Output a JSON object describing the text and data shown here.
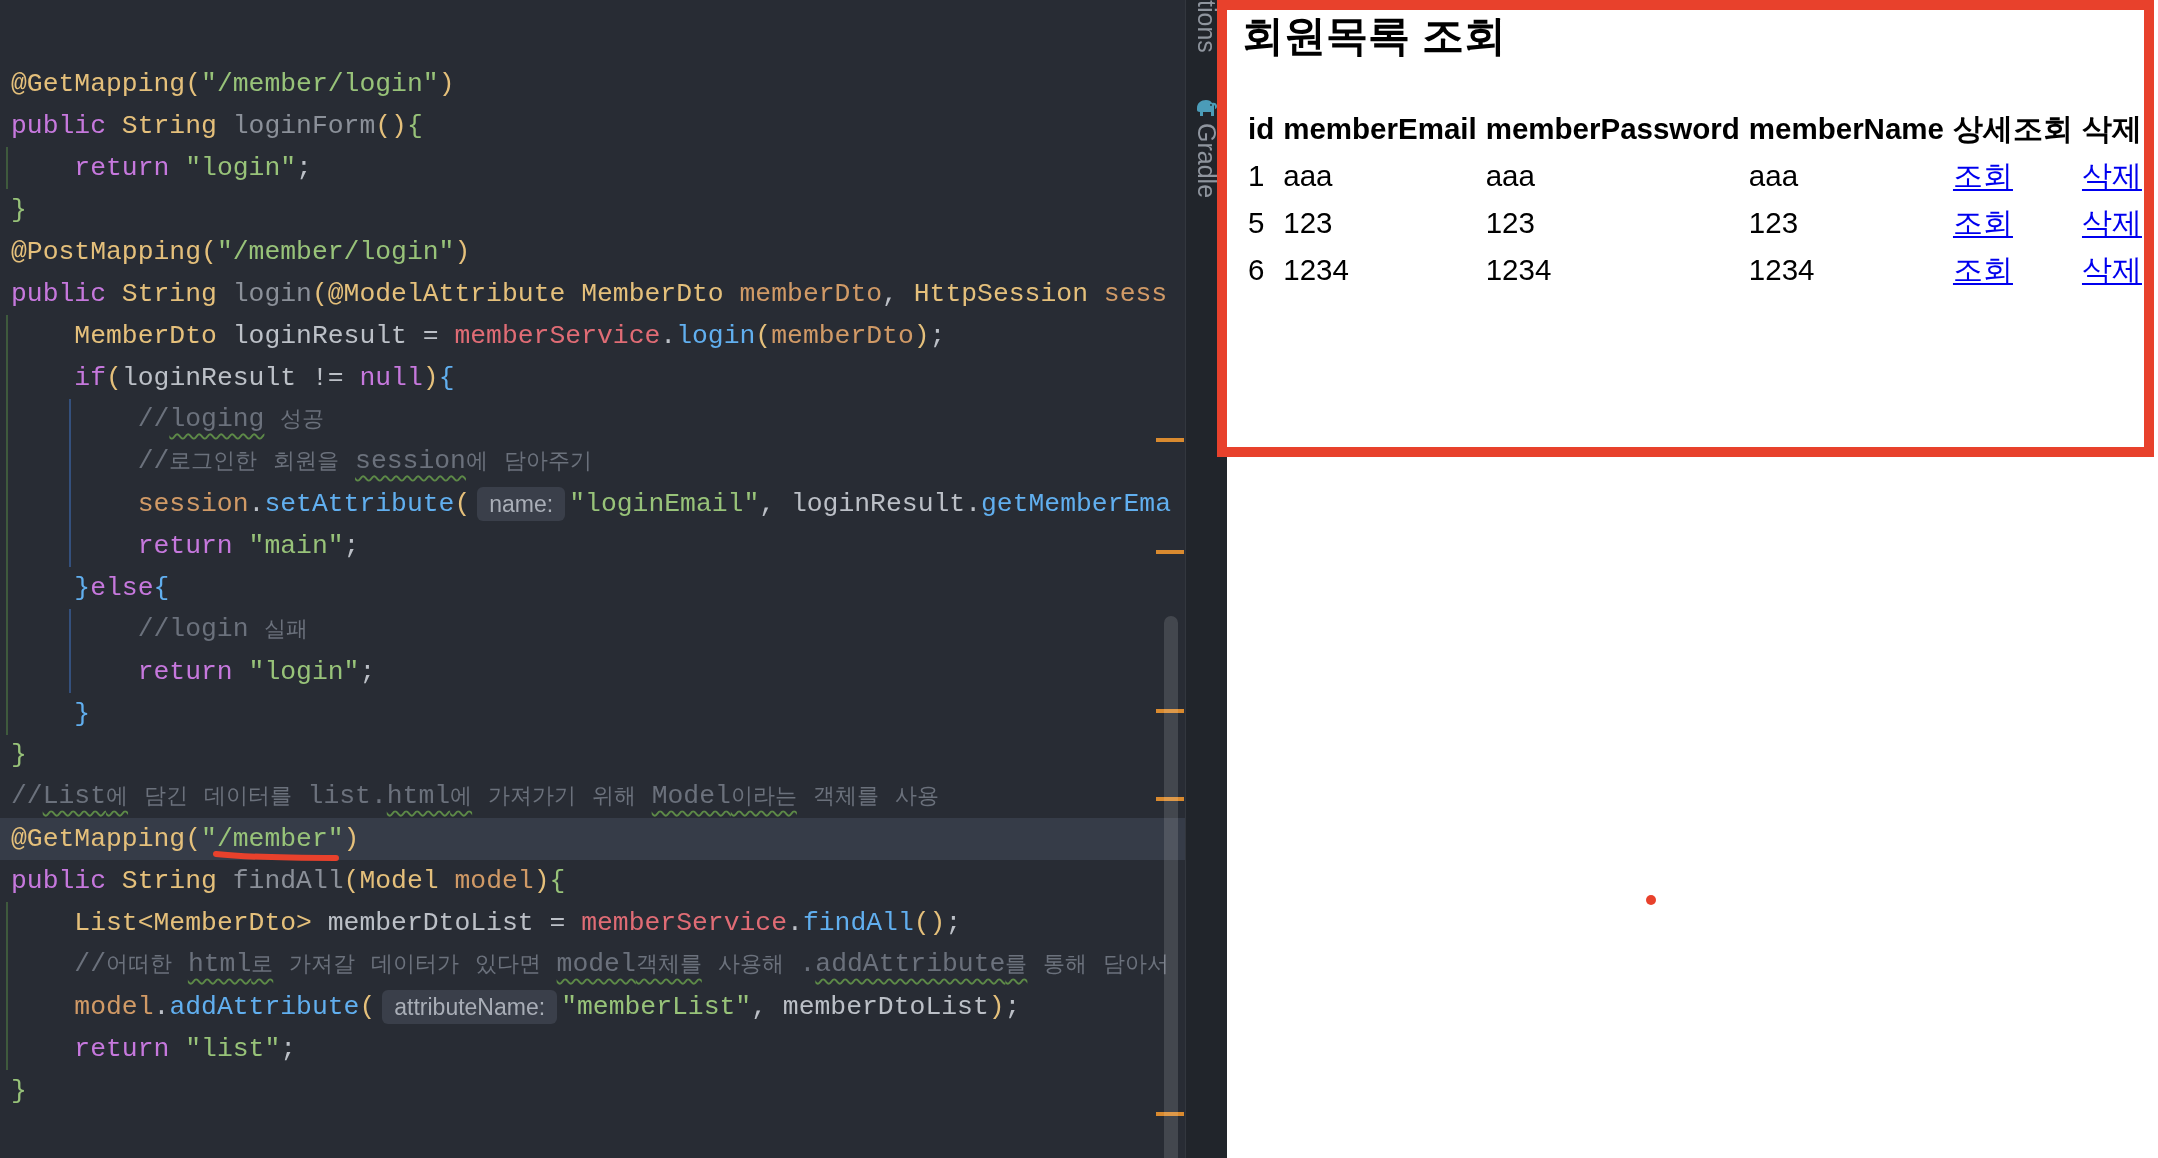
{
  "editor": {
    "lines": [
      {
        "highlighted": false,
        "tokens": [
          {
            "kind": "annotation",
            "text": "@GetMapping"
          },
          {
            "kind": "bracket",
            "text": "("
          },
          {
            "kind": "string",
            "text": "\"/member/login\""
          },
          {
            "kind": "bracket",
            "text": ")"
          }
        ]
      },
      {
        "highlighted": false,
        "tokens": [
          {
            "kind": "keyword",
            "text": "public "
          },
          {
            "kind": "type",
            "text": "String "
          },
          {
            "kind": "declaration",
            "text": "loginForm"
          },
          {
            "kind": "bracket",
            "text": "()"
          },
          {
            "kind": "brace_outer",
            "text": "{"
          }
        ],
        "children": [
          {
            "highlighted": false,
            "tokens": [
              {
                "kind": "keyword",
                "text": "return "
              },
              {
                "kind": "string",
                "text": "\"login\""
              },
              {
                "kind": "plain",
                "text": ";"
              }
            ]
          }
        ]
      },
      {
        "highlighted": false,
        "tokens": [
          {
            "kind": "brace_outer",
            "text": "}"
          }
        ]
      },
      {
        "highlighted": false,
        "tokens": [
          {
            "kind": "annotation",
            "text": "@PostMapping"
          },
          {
            "kind": "bracket",
            "text": "("
          },
          {
            "kind": "string",
            "text": "\"/member/login\""
          },
          {
            "kind": "bracket",
            "text": ")"
          }
        ]
      },
      {
        "highlighted": false,
        "tokens": [
          {
            "kind": "keyword",
            "text": "public "
          },
          {
            "kind": "type",
            "text": "String "
          },
          {
            "kind": "declaration",
            "text": "login"
          },
          {
            "kind": "bracket",
            "text": "("
          },
          {
            "kind": "annotation",
            "text": "@ModelAttribute "
          },
          {
            "kind": "type",
            "text": "MemberDto "
          },
          {
            "kind": "param",
            "text": "memberDto"
          },
          {
            "kind": "plain",
            "text": ", "
          },
          {
            "kind": "type",
            "text": "HttpSession "
          },
          {
            "kind": "param",
            "text": "sess"
          }
        ],
        "children": [
          {
            "highlighted": false,
            "tokens": [
              {
                "kind": "type",
                "text": "MemberDto "
              },
              {
                "kind": "plain",
                "text": "loginResult = "
              },
              {
                "kind": "field",
                "text": "memberService"
              },
              {
                "kind": "plain",
                "text": "."
              },
              {
                "kind": "method",
                "text": "login"
              },
              {
                "kind": "bracket",
                "text": "("
              },
              {
                "kind": "param",
                "text": "memberDto"
              },
              {
                "kind": "bracket",
                "text": ")"
              },
              {
                "kind": "plain",
                "text": ";"
              }
            ]
          },
          {
            "highlighted": false,
            "tokens": [
              {
                "kind": "keyword",
                "text": "if"
              },
              {
                "kind": "bracket",
                "text": "("
              },
              {
                "kind": "plain",
                "text": "loginResult != "
              },
              {
                "kind": "keyword",
                "text": "null"
              },
              {
                "kind": "bracket",
                "text": ")"
              },
              {
                "kind": "brace_inner",
                "text": "{"
              }
            ],
            "children": [
              {
                "highlighted": false,
                "tokens": [
                  {
                    "kind": "comment",
                    "text": "//"
                  },
                  {
                    "kind": "comment_typo",
                    "text": "loging"
                  },
                  {
                    "kind": "comment",
                    "text": " 성공"
                  }
                ]
              },
              {
                "highlighted": false,
                "tokens": [
                  {
                    "kind": "comment",
                    "text": "//로그인한 회원을 "
                  },
                  {
                    "kind": "comment_typo",
                    "text": "session"
                  },
                  {
                    "kind": "comment",
                    "text": "에 담아주기"
                  }
                ]
              },
              {
                "highlighted": false,
                "tokens": [
                  {
                    "kind": "param",
                    "text": "session"
                  },
                  {
                    "kind": "plain",
                    "text": "."
                  },
                  {
                    "kind": "method",
                    "text": "setAttribute"
                  },
                  {
                    "kind": "bracket",
                    "text": "("
                  },
                  {
                    "kind": "hint",
                    "text": "name:"
                  },
                  {
                    "kind": "string",
                    "text": "\"loginEmail\""
                  },
                  {
                    "kind": "plain",
                    "text": ", loginResult."
                  },
                  {
                    "kind": "method",
                    "text": "getMemberEma"
                  }
                ]
              },
              {
                "highlighted": false,
                "tokens": [
                  {
                    "kind": "keyword",
                    "text": "return "
                  },
                  {
                    "kind": "string",
                    "text": "\"main\""
                  },
                  {
                    "kind": "plain",
                    "text": ";"
                  }
                ]
              }
            ]
          },
          {
            "highlighted": false,
            "tokens": [
              {
                "kind": "brace_inner",
                "text": "}"
              },
              {
                "kind": "keyword",
                "text": "else"
              },
              {
                "kind": "brace_inner",
                "text": "{"
              }
            ],
            "children": [
              {
                "highlighted": false,
                "tokens": [
                  {
                    "kind": "comment",
                    "text": "//login 실패"
                  }
                ]
              },
              {
                "highlighted": false,
                "tokens": [
                  {
                    "kind": "keyword",
                    "text": "return "
                  },
                  {
                    "kind": "string",
                    "text": "\"login\""
                  },
                  {
                    "kind": "plain",
                    "text": ";"
                  }
                ]
              }
            ]
          },
          {
            "highlighted": false,
            "tokens": [
              {
                "kind": "brace_inner",
                "text": "}"
              }
            ]
          }
        ]
      },
      {
        "highlighted": false,
        "tokens": [
          {
            "kind": "brace_outer",
            "text": "}"
          }
        ]
      },
      {
        "highlighted": false,
        "tokens": [
          {
            "kind": "comment",
            "text": "//"
          },
          {
            "kind": "comment_typo",
            "text": "List에"
          },
          {
            "kind": "comment",
            "text": " 담긴 데이터를 list."
          },
          {
            "kind": "comment_typo",
            "text": "html에"
          },
          {
            "kind": "comment",
            "text": " 가져가기 위해 "
          },
          {
            "kind": "comment_typo",
            "text": "Model이라는"
          },
          {
            "kind": "comment",
            "text": " 객체를 사용"
          }
        ]
      },
      {
        "highlighted": true,
        "tokens": [
          {
            "kind": "annotation",
            "text": "@GetMapping"
          },
          {
            "kind": "bracket",
            "text": "("
          },
          {
            "kind": "string",
            "text": "\"/member\""
          },
          {
            "kind": "bracket",
            "text": ")"
          }
        ]
      },
      {
        "highlighted": false,
        "tokens": [
          {
            "kind": "keyword",
            "text": "public "
          },
          {
            "kind": "type",
            "text": "String "
          },
          {
            "kind": "declaration",
            "text": "findAll"
          },
          {
            "kind": "bracket",
            "text": "("
          },
          {
            "kind": "type",
            "text": "Model "
          },
          {
            "kind": "param",
            "text": "model"
          },
          {
            "kind": "bracket",
            "text": ")"
          },
          {
            "kind": "brace_outer",
            "text": "{"
          }
        ],
        "children": [
          {
            "highlighted": false,
            "tokens": [
              {
                "kind": "type",
                "text": "List<MemberDto> "
              },
              {
                "kind": "plain",
                "text": "memberDtoList = "
              },
              {
                "kind": "field",
                "text": "memberService"
              },
              {
                "kind": "plain",
                "text": "."
              },
              {
                "kind": "method",
                "text": "findAll"
              },
              {
                "kind": "bracket",
                "text": "()"
              },
              {
                "kind": "plain",
                "text": ";"
              }
            ]
          },
          {
            "highlighted": false,
            "tokens": [
              {
                "kind": "comment",
                "text": "//어떠한 "
              },
              {
                "kind": "comment_typo",
                "text": "html로"
              },
              {
                "kind": "comment",
                "text": " 가져갈 데이터가 있다면 "
              },
              {
                "kind": "comment_typo",
                "text": "model객체를"
              },
              {
                "kind": "comment",
                "text": " 사용해 ."
              },
              {
                "kind": "comment_typo",
                "text": "addAttribute를"
              },
              {
                "kind": "comment",
                "text": " 통해 담아서"
              }
            ]
          },
          {
            "highlighted": false,
            "tokens": [
              {
                "kind": "param",
                "text": "model"
              },
              {
                "kind": "plain",
                "text": "."
              },
              {
                "kind": "method",
                "text": "addAttribute"
              },
              {
                "kind": "bracket",
                "text": "("
              },
              {
                "kind": "hint",
                "text": "attributeName:"
              },
              {
                "kind": "string",
                "text": "\"memberList\""
              },
              {
                "kind": "plain",
                "text": ", memberDtoList"
              },
              {
                "kind": "bracket",
                "text": ")"
              },
              {
                "kind": "plain",
                "text": ";"
              }
            ]
          },
          {
            "highlighted": false,
            "tokens": [
              {
                "kind": "keyword",
                "text": "return "
              },
              {
                "kind": "string",
                "text": "\"list\""
              },
              {
                "kind": "plain",
                "text": ";"
              }
            ]
          }
        ]
      },
      {
        "highlighted": false,
        "tokens": [
          {
            "kind": "brace_outer",
            "text": "}"
          }
        ]
      }
    ]
  },
  "tool_windows": [
    {
      "label": "tions",
      "kind": "text"
    },
    {
      "label": "Gradle",
      "kind": "gradle"
    }
  ],
  "browser": {
    "heading": "회원목록 조회",
    "columns": [
      "id",
      "memberEmail",
      "memberPassword",
      "memberName",
      "상세조회",
      "삭제"
    ],
    "rows": [
      {
        "cells": [
          "1",
          "aaa",
          "aaa",
          "aaa"
        ],
        "links": [
          "조회",
          "삭제"
        ]
      },
      {
        "cells": [
          "5",
          "123",
          "123",
          "123"
        ],
        "links": [
          "조회",
          "삭제"
        ]
      },
      {
        "cells": [
          "6",
          "1234",
          "1234",
          "1234"
        ],
        "links": [
          "조회",
          "삭제"
        ]
      }
    ]
  }
}
